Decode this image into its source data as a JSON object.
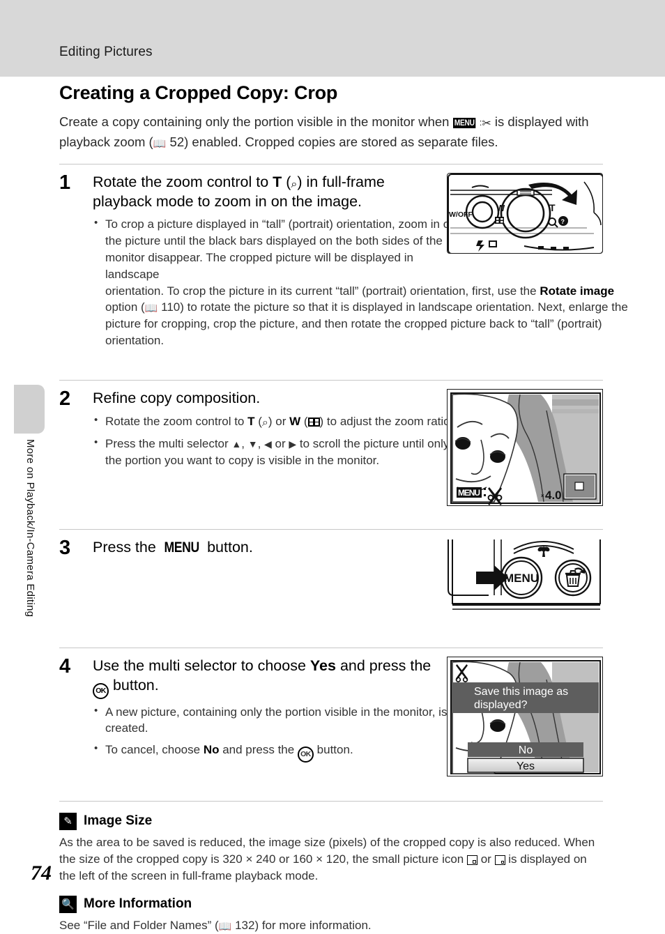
{
  "header": {
    "running_head": "Editing Pictures"
  },
  "sidebar": {
    "chapter_label": "More on Playback/In-Camera Editing",
    "page_number": "74"
  },
  "section": {
    "title": "Creating a Cropped Copy: Crop",
    "intro_part1": "Create a copy containing only the portion visible in the monitor when ",
    "intro_menu_icon": "MENU",
    "intro_part2": " is displayed with playback zoom (",
    "intro_ref_page": "52",
    "intro_part3": ") enabled. Cropped copies are stored as separate files."
  },
  "steps": [
    {
      "number": "1",
      "heading_part1": "Rotate the zoom control to ",
      "heading_bold": "T",
      "heading_part2": " (",
      "heading_part3": ") in full-frame playback mode to zoom in on the image.",
      "bullets": [
        "To crop a picture displayed in “tall” (portrait) orientation, zoom in on the picture until the black bars displayed on the both sides of the monitor disappear. The cropped picture will be displayed in landscape"
      ],
      "continuation_part1": "orientation. To crop the picture in its current “tall” (portrait) orientation, first, use the ",
      "continuation_bold": "Rotate image",
      "continuation_part2": " option (",
      "continuation_ref_page": "110",
      "continuation_part3": ") to rotate the picture so that it is displayed in landscape orientation. Next, enlarge the picture for cropping, crop the picture, and then rotate the cropped picture back to “tall” (portrait) orientation.",
      "illustration": "camera-top-zoom-control"
    },
    {
      "number": "2",
      "heading": "Refine copy composition.",
      "bullet1_part1": "Rotate the zoom control to ",
      "bullet1_boldT": "T",
      "bullet1_part2": " (",
      "bullet1_part3": ") or ",
      "bullet1_boldW": "W",
      "bullet1_part4": " (",
      "bullet1_part5": ") to adjust the zoom ratio.",
      "bullet2_part1": "Press the multi selector ",
      "bullet2_part2": ", ",
      "bullet2_part3": ", ",
      "bullet2_part4": " or ",
      "bullet2_part5": " to scroll the picture until only the portion you want to copy is visible in the monitor.",
      "illustration": "monitor-zoomed-face"
    },
    {
      "number": "3",
      "heading_part1": "Press the ",
      "heading_menu": "MENU",
      "heading_part2": " button.",
      "illustration": "camera-back-menu-button"
    },
    {
      "number": "4",
      "heading_part1": "Use the multi selector to choose ",
      "heading_bold": "Yes",
      "heading_part2": " and press the ",
      "heading_ok": "OK",
      "heading_part3": " button.",
      "bullet1": "A new picture, containing only the portion visible in the monitor, is created.",
      "bullet2_part1": "To cancel, choose ",
      "bullet2_bold": "No",
      "bullet2_part2": " and press the ",
      "bullet2_part3": " button.",
      "illustration": "monitor-save-confirm-dialog"
    }
  ],
  "illustration_labels": {
    "camera_top": {
      "power_label": "W/OFF",
      "wide_label": "W",
      "tele_label": "T"
    },
    "monitor_step2": {
      "menu_icon": "MENU",
      "zoom_ratio": "×4.0"
    },
    "camera_back": {
      "menu_button": "MENU"
    },
    "dialog_step4": {
      "message_line1": "Save this image as",
      "message_line2": "displayed?",
      "option_no": "No",
      "option_yes": "Yes"
    }
  },
  "notes": [
    {
      "icon": "pencil-icon",
      "title": "Image Size",
      "body_part1": "As the area to be saved is reduced, the image size (pixels) of the cropped copy is also reduced. When the size of the cropped copy is 320 × 240 or 160 × 120, the small picture icon ",
      "body_part2": " or ",
      "body_part3": " is displayed on the left of the screen in full-frame playback mode."
    },
    {
      "icon": "magnifier-icon",
      "title": "More Information",
      "body_part1": "See “File and Folder Names” (",
      "body_ref_page": "132",
      "body_part2": ") for more information."
    }
  ],
  "colors": {
    "header_band": "#d8d8d8",
    "side_tab": "#d0d0d0",
    "rule": "#c6c6c6",
    "text": "#333333"
  }
}
